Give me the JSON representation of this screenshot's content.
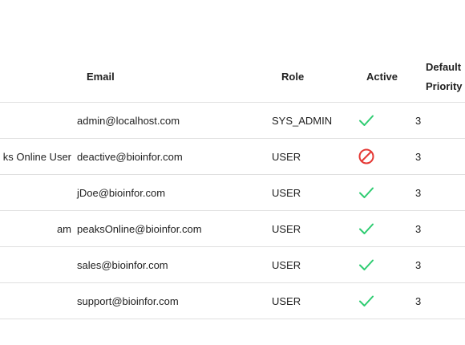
{
  "columns": {
    "email": "Email",
    "role": "Role",
    "active": "Active",
    "priority_line1": "Default",
    "priority_line2": "Priority"
  },
  "rows": [
    {
      "name": "",
      "email": "admin@localhost.com",
      "role": "SYS_ADMIN",
      "active": "check-icon",
      "priority": "3"
    },
    {
      "name": "ks Online User",
      "email": "deactive@bioinfor.com",
      "role": "USER",
      "active": "blocked-icon",
      "priority": "3"
    },
    {
      "name": "",
      "email": "jDoe@bioinfor.com",
      "role": "USER",
      "active": "check-icon",
      "priority": "3"
    },
    {
      "name": "am",
      "email": "peaksOnline@bioinfor.com",
      "role": "USER",
      "active": "check-icon",
      "priority": "3"
    },
    {
      "name": "",
      "email": "sales@bioinfor.com",
      "role": "USER",
      "active": "check-icon",
      "priority": "3"
    },
    {
      "name": "",
      "email": "support@bioinfor.com",
      "role": "USER",
      "active": "check-icon",
      "priority": "3"
    }
  ],
  "colors": {
    "check": "#2ecc71",
    "blocked": "#e53935",
    "divider": "#e0e0e0"
  }
}
